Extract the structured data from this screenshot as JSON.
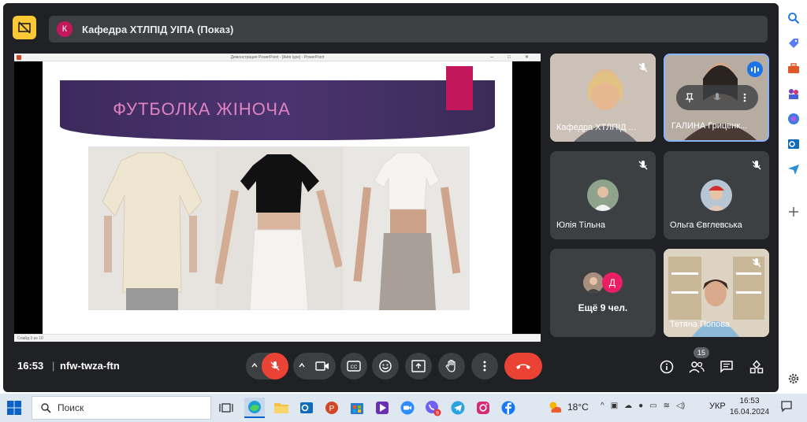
{
  "header": {
    "avatar_letter": "К",
    "title": "Кафедра ХТЛПІД УІПА (Показ)"
  },
  "presentation": {
    "window_title": "Демонстрация PowerPoint - [Київ Іуре] - PowerPoint",
    "slide_title": "ФУТБОЛКА ЖІНОЧА",
    "status": "Слайд 3 из 10"
  },
  "tiles": {
    "kafedra": {
      "name": "Кафедра ХТЛПІД ..."
    },
    "galyna": {
      "name": "ГАЛИНА Гриценк..."
    },
    "yuliia": {
      "name": "Юлія Тільна"
    },
    "olha": {
      "name": "Ольга Євглевська"
    },
    "more": {
      "avatar_letter": "Д",
      "label": "Ещё 9 чел."
    },
    "tetiana": {
      "name": "Тетяна Попова"
    }
  },
  "bottom_bar": {
    "time": "16:53",
    "separator": "|",
    "meeting_code": "nfw-twza-ftn",
    "people_count": "15"
  },
  "taskbar": {
    "search_label": "Поиск",
    "weather_temp": "18°C",
    "language": "УКР",
    "clock_time": "16:53",
    "clock_date": "16.04.2024",
    "viber_badge": "9"
  },
  "colors": {
    "meet_bg": "#202124",
    "tile_bg": "#3c4043",
    "accent_red": "#ea4335",
    "speaker_blue": "#1a73e8",
    "present_yellow": "#fcc934",
    "slide_title_pink": "#e082c2",
    "slide_banner_purple": "#3d2a5c"
  }
}
